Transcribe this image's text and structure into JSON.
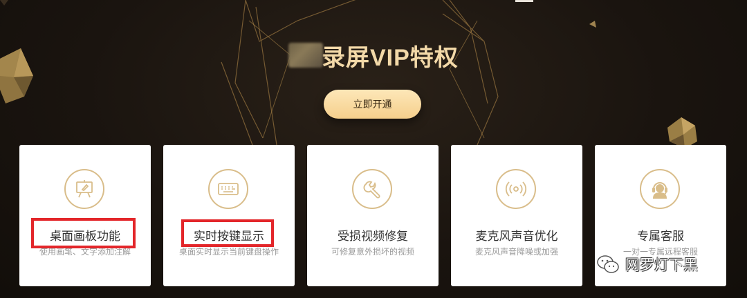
{
  "header": {
    "title": "录屏VIP特权",
    "open_button": "立即开通"
  },
  "features": [
    {
      "title": "桌面画板功能",
      "desc": "使用画笔、文字添加注解",
      "icon": "easel-pen-icon",
      "highlighted": true
    },
    {
      "title": "实时按键显示",
      "desc": "桌面实时显示当前键盘操作",
      "icon": "keyboard-icon",
      "highlighted": true
    },
    {
      "title": "受损视频修复",
      "desc": "可修复意外损坏的视频",
      "icon": "wrench-icon",
      "highlighted": false
    },
    {
      "title": "麦克风声音优化",
      "desc": "麦克风声音降噪或加强",
      "icon": "broadcast-icon",
      "highlighted": false
    },
    {
      "title": "专属客服",
      "desc": "一对一专属远程客服",
      "icon": "headset-agent-icon",
      "highlighted": false
    }
  ],
  "watermark": {
    "text": "网罗灯下黑",
    "icon": "wechat-icon"
  },
  "colors": {
    "background": "#1a140f",
    "gold": "#f3d9a8",
    "button": "#f5cf8c",
    "highlight": "#e3262a",
    "icon_stroke": "#d9bd8a"
  }
}
